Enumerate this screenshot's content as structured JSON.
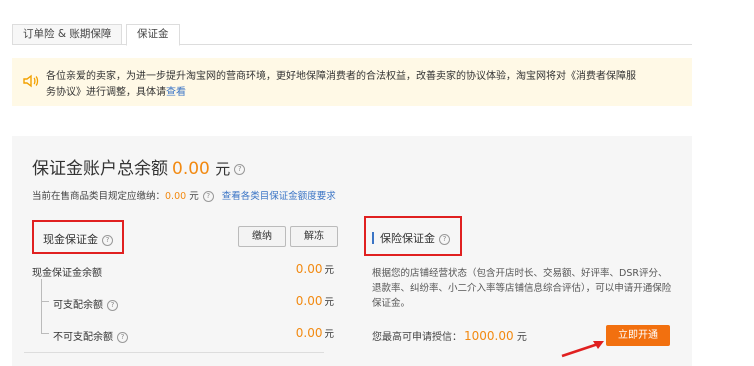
{
  "tabs": [
    {
      "label": "订单险 & 账期保障"
    },
    {
      "label": "保证金",
      "active": true
    }
  ],
  "notice": {
    "icon": "speaker-icon",
    "text": "各位亲爱的卖家，为进一步提升淘宝网的营商环境，更好地保障消费者的合法权益，改善卖家的协议体验，淘宝网将对《消费者保障服务协议》进行调整，具体请",
    "link": "查看"
  },
  "account": {
    "title": "保证金账户总余额",
    "amount": "0.00",
    "unit": "元",
    "sub_label": "当前在售商品类目规定应缴纳：",
    "sub_amount": "0.00",
    "sub_unit": "元",
    "sub_link": "查看各类目保证金额度要求"
  },
  "cash": {
    "title": "现金保证金",
    "btn_pay": "缴纳",
    "btn_release": "解冻",
    "rows": [
      {
        "label": "现金保证金余额",
        "value": "0.00",
        "unit": "元"
      },
      {
        "label": "可支配余额",
        "value": "0.00",
        "unit": "元"
      },
      {
        "label": "不可支配余额",
        "value": "0.00",
        "unit": "元"
      }
    ]
  },
  "insurance": {
    "title": "保险保证金",
    "desc": "根据您的店铺经营状态（包含开店时长、交易额、好评率、DSR评分、退款率、纠纷率、小二介入率等店铺信息综合评估），可以申请开通保险保证金。",
    "credit_label": "您最高可申请授信：",
    "credit_amount": "1000.00",
    "credit_unit": "元",
    "open_btn": "立即开通"
  },
  "colors": {
    "accent": "#f28a12",
    "link": "#3a74c5",
    "highlight": "#e02020",
    "button": "#f2700f"
  }
}
